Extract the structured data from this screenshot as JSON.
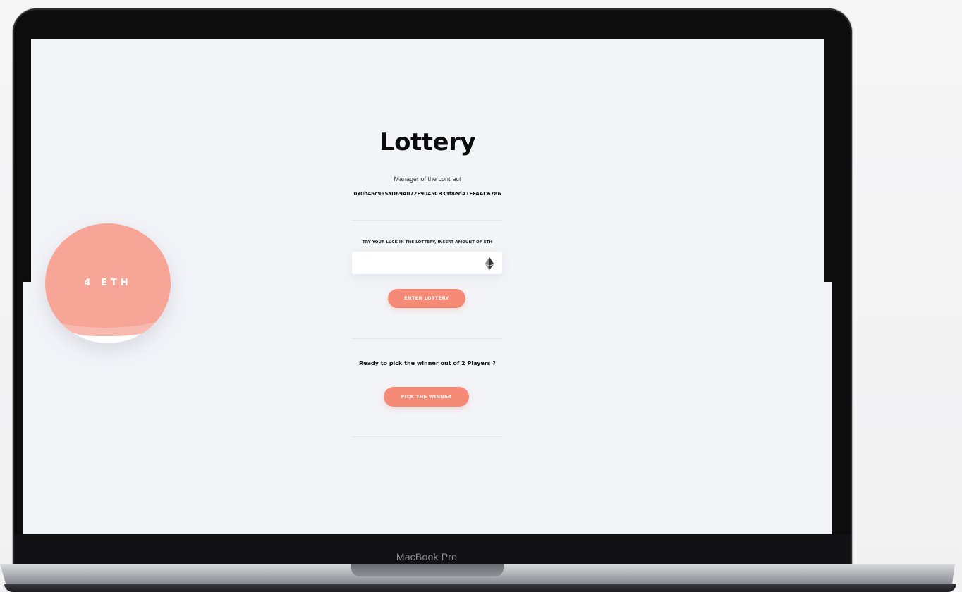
{
  "device": {
    "label": "MacBook Pro"
  },
  "app": {
    "title": "Lottery",
    "manager_label": "Manager of the contract",
    "manager_address": "0x0b46c965aD69A072E9045CB33f8edA1EFAAC6786",
    "try_label": "TRY YOUR LUCK IN THE LOTTERY, INSERT AMOUNT OF ETH",
    "amount_input": {
      "value": "",
      "placeholder": "",
      "icon": "ethereum-icon"
    },
    "enter_button_label": "ENTER LOTTERY",
    "ready_text": "Ready to pick the winner out of 2 Players ?",
    "pick_button_label": "PICK THE WINNER",
    "pot_label": "4 ETH"
  },
  "colors": {
    "accent": "#f58a77",
    "pot_fill": "#f7a597",
    "background": "#f3f4f8"
  }
}
